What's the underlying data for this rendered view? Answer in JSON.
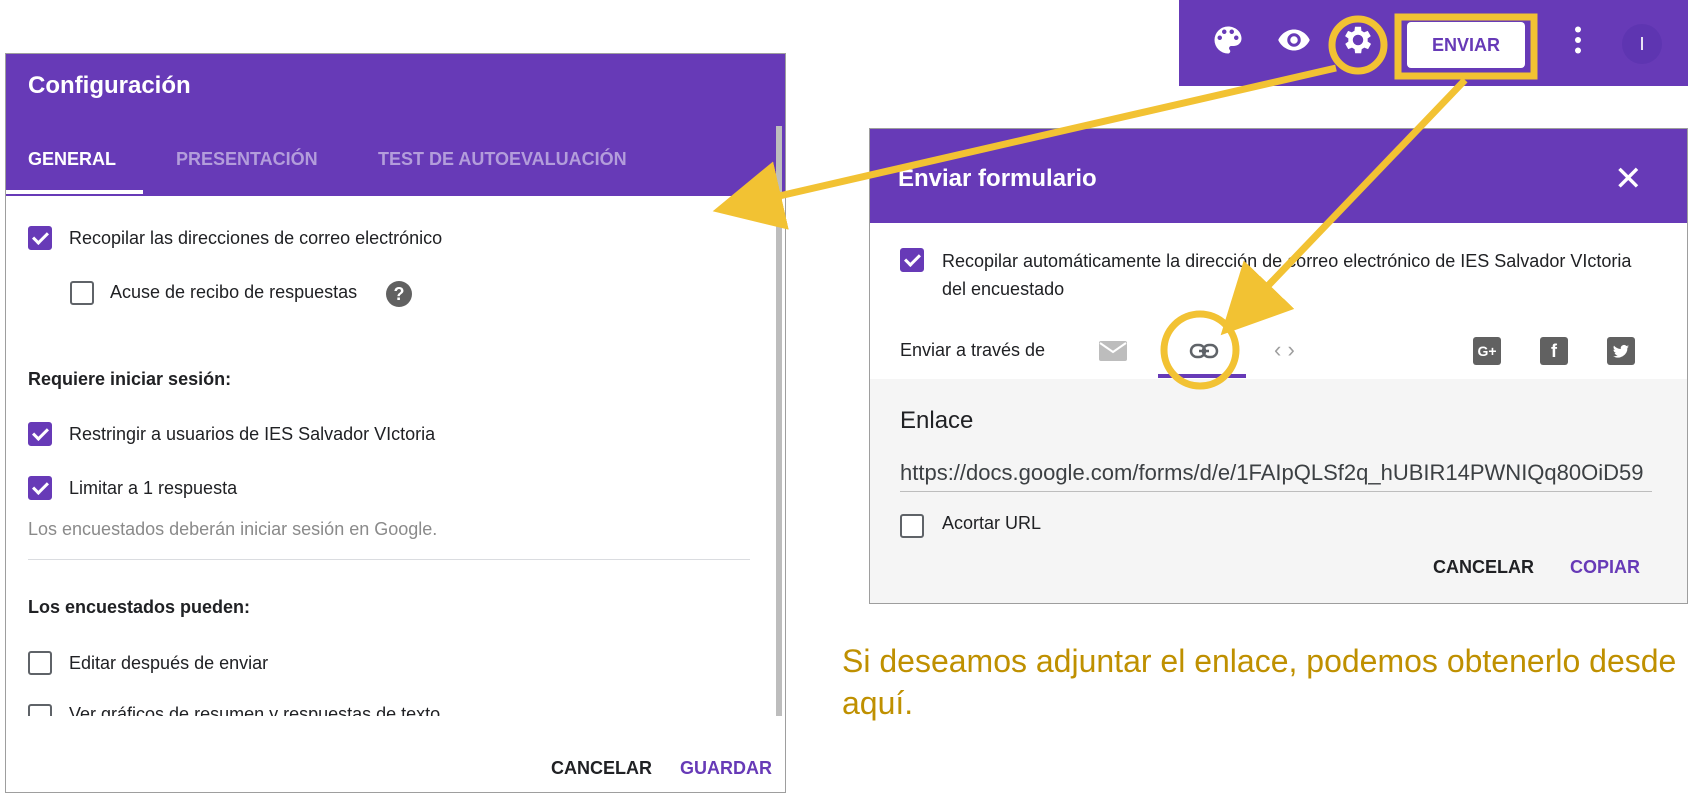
{
  "settings_dialog": {
    "title": "Configuración",
    "tabs": [
      "GENERAL",
      "PRESENTACIÓN",
      "TEST DE AUTOEVALUACIÓN"
    ],
    "collect_emails": "Recopilar las direcciones de correo electrónico",
    "response_receipts": "Acuse de recibo de respuestas",
    "help_glyph": "?",
    "login_required_heading": "Requiere iniciar sesión:",
    "restrict_users": "Restringir a usuarios de IES Salvador VIctoria",
    "limit_one": "Limitar a 1 respuesta",
    "login_hint": "Los encuestados deberán iniciar sesión en Google.",
    "respondents_can_heading": "Los encuestados pueden:",
    "edit_after": "Editar después de enviar",
    "see_summary": "Ver gráficos de resumen y respuestas de texto",
    "cancel": "CANCELAR",
    "save": "GUARDAR"
  },
  "toolbar": {
    "icons": [
      "palette-icon",
      "eye-icon",
      "gear-icon",
      "more-vert-icon"
    ],
    "send_button": "ENVIAR",
    "avatar_letter": "I"
  },
  "send_dialog": {
    "title": "Enviar formulario",
    "auto_collect": "Recopilar automáticamente la dirección de correo electrónico de IES Salvador VIctoria del encuestado",
    "send_via": "Enviar a través de",
    "link_heading": "Enlace",
    "link_url": "https://docs.google.com/forms/d/e/1FAIpQLSf2q_hUBIR14PWNIQq80OiD59",
    "shorten_url": "Acortar URL",
    "cancel": "CANCELAR",
    "copy": "COPIAR",
    "social": {
      "google_plus": "G+",
      "facebook": "f"
    }
  },
  "annotation": {
    "caption": "Si deseamos adjuntar el enlace, podemos obtenerlo desde aquí."
  },
  "colors": {
    "brand_purple": "#673ab7",
    "annotation_yellow": "#f2c233",
    "caption_gold": "#bf9000"
  }
}
